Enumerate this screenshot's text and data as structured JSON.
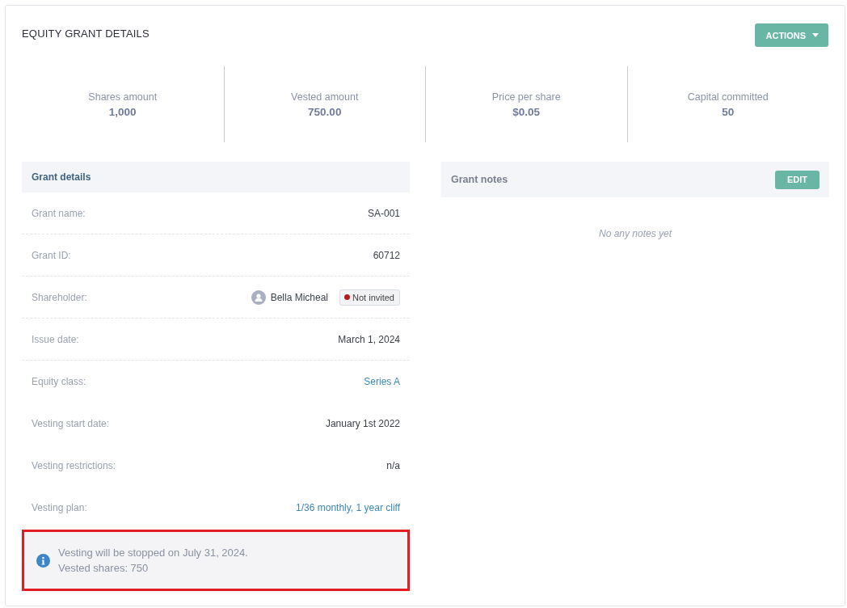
{
  "title": "EQUITY GRANT DETAILS",
  "actions_button": "ACTIONS",
  "stats": [
    {
      "label": "Shares amount",
      "value": "1,000"
    },
    {
      "label": "Vested amount",
      "value": "750.00"
    },
    {
      "label": "Price per share",
      "value": "$0.05"
    },
    {
      "label": "Capital committed",
      "value": "50"
    }
  ],
  "grant_details": {
    "title": "Grant details",
    "rows": [
      {
        "kind": "text",
        "label": "Grant name:",
        "value": "SA-001",
        "divider": true
      },
      {
        "kind": "text",
        "label": "Grant ID:",
        "value": "60712",
        "divider": true
      },
      {
        "kind": "person",
        "label": "Shareholder:",
        "value": "Bella Micheal",
        "badge": {
          "label": "Not invited",
          "color": "#b71c1c"
        },
        "divider": true
      },
      {
        "kind": "text",
        "label": "Issue date:",
        "value": "March 1, 2024",
        "divider": true
      },
      {
        "kind": "link",
        "label": "Equity class:",
        "value": "Series A",
        "divider": false
      },
      {
        "kind": "text",
        "label": "Vesting start date:",
        "value": "January 1st 2022",
        "divider": false
      },
      {
        "kind": "text",
        "label": "Vesting restrictions:",
        "value": "n/a",
        "divider": false
      },
      {
        "kind": "link",
        "label": "Vesting plan:",
        "value": "1/36 monthly, 1 year cliff",
        "divider": false
      }
    ],
    "notice": {
      "lines": [
        "Vesting will be stopped on July 31, 2024.",
        "Vested shares: 750"
      ],
      "highlighted": true
    }
  },
  "grant_notes": {
    "title": "Grant notes",
    "edit_button": "EDIT",
    "empty_text": "No any notes yet"
  }
}
